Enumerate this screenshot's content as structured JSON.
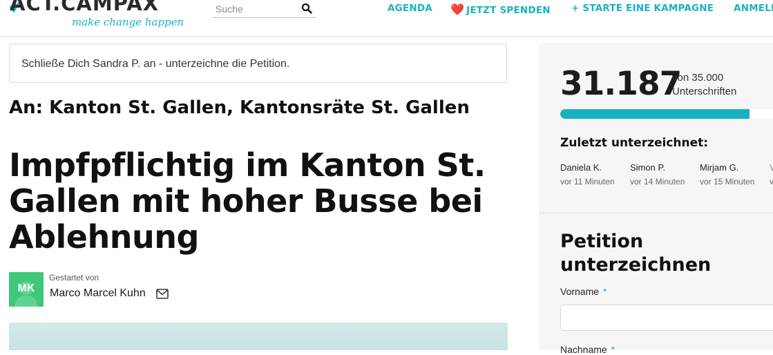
{
  "header": {
    "logo_text": "ACT.CAMPAX",
    "logo_tagline": "make change happen",
    "search": {
      "placeholder": "Suche",
      "value": ""
    },
    "nav": [
      {
        "label": "AGENDA"
      },
      {
        "label": "JETZT SPENDEN",
        "icon": "heart-icon"
      },
      {
        "label": "+ STARTE EINE KAMPAGNE"
      },
      {
        "label": "ANMELDEN"
      }
    ]
  },
  "main": {
    "join_message": "Schließe Dich Sandra P. an - unterzeichne die Petition.",
    "target": "An: Kanton St. Gallen, Kantonsräte St. Gallen",
    "title": "Impfpflichtig im Kanton St. Gallen mit hoher Busse bei Ablehnung",
    "author": {
      "initials": "MK",
      "started_label": "Gestartet von",
      "name": "Marco Marcel Kuhn"
    }
  },
  "sidebar": {
    "signature_count": "31.187",
    "goal_line1": "von 35.000",
    "goal_line2": "Unterschriften",
    "progress_fraction": 0.891,
    "recent_heading": "Zuletzt unterzeichnet:",
    "recent_signers": [
      {
        "name": "Daniela K.",
        "time": "vor 11 Minuten"
      },
      {
        "name": "Simon P.",
        "time": "vor 14 Minuten"
      },
      {
        "name": "Mirjam G.",
        "time": "vor 15 Minuten"
      },
      {
        "name": "V",
        "time": "v"
      }
    ],
    "sign_heading": "Petition unterzeichnen",
    "form": {
      "first_name_label": "Vorname",
      "first_name_value": "",
      "last_name_label": "Nachname",
      "required_marker": "*"
    }
  },
  "colors": {
    "accent": "#18b2c2",
    "avatar": "#3fc77a",
    "heart": "#e0242b"
  }
}
